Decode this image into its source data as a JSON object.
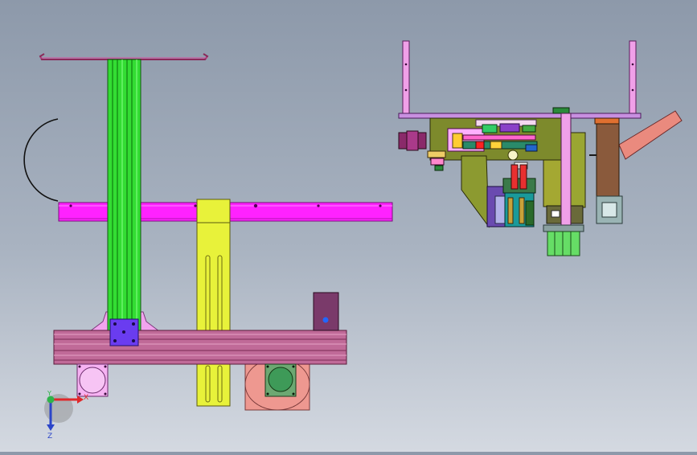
{
  "viewport": {
    "background_top": "#8d99aa",
    "background_bottom": "#d4d9e1"
  },
  "triad": {
    "x_label": "X",
    "y_label": "Y",
    "z_label": "Z",
    "x_color": "#e0282a",
    "y_color": "#2fb34a",
    "z_color": "#2b45c9"
  },
  "colors": {
    "magenta_beam": "#ff22ff",
    "green_column": "#33dd33",
    "yellow_bracket": "#e8f23a",
    "mauve_rail": "#c06a98",
    "pink_part": "#f1a6f0",
    "olive_block": "#9aa832",
    "salmon_part": "#e8887e",
    "brown_block": "#8a5a3c"
  }
}
